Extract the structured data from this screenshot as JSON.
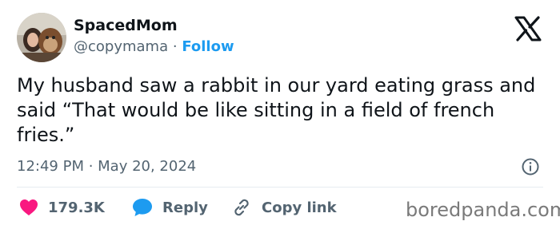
{
  "author": {
    "name": "SpacedMom",
    "handle": "@copymama",
    "separator": "·",
    "follow_label": "Follow"
  },
  "tweet": {
    "text": "My husband saw a rabbit in our yard eating grass and said “That would be like sitting in a field of french fries.”",
    "timestamp": "12:49 PM · May 20, 2024"
  },
  "actions": {
    "likes_count": "179.3K",
    "reply_label": "Reply",
    "copy_link_label": "Copy link"
  },
  "watermark": "boredpanda.com",
  "icons": {
    "x_logo": "x-logo-icon",
    "info": "info-icon",
    "heart": "heart-icon",
    "reply": "reply-bubble-icon",
    "link": "link-icon"
  },
  "colors": {
    "follow": "#1d9bf0",
    "heart": "#f91880",
    "reply": "#1d9bf0",
    "muted": "#536471",
    "text": "#0f1419"
  }
}
